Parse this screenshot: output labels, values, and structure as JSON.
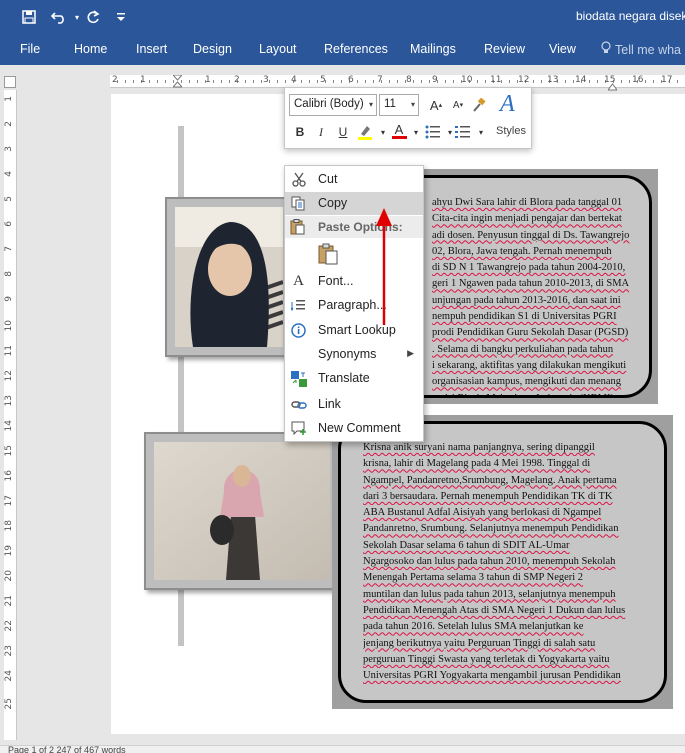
{
  "title_bar": {
    "doc_title": "biodata negara disek",
    "icons": [
      "save-icon",
      "undo-icon",
      "redo-icon",
      "customize-qat-icon"
    ]
  },
  "ribbon": {
    "tabs": [
      "File",
      "Home",
      "Insert",
      "Design",
      "Layout",
      "References",
      "Mailings",
      "Review",
      "View"
    ],
    "tell_me": "Tell me wha"
  },
  "ruler": {
    "h_numbers": [
      "2",
      "1",
      "1",
      "2",
      "3",
      "4",
      "5",
      "6",
      "7",
      "8",
      "9",
      "10",
      "11",
      "12",
      "13",
      "14",
      "15",
      "16",
      "17",
      "18"
    ],
    "v_numbers": [
      "1",
      "2",
      "3",
      "4",
      "5",
      "6",
      "7",
      "8",
      "9",
      "10",
      "11",
      "12",
      "13",
      "14",
      "15",
      "16",
      "17",
      "18",
      "19",
      "20",
      "21",
      "22",
      "23",
      "24",
      "25"
    ]
  },
  "mini_toolbar": {
    "font_name": "Calibri (Body)",
    "font_size": "11",
    "grow_font": "A",
    "shrink_font": "A",
    "bold": "B",
    "italic": "I",
    "underline": "U",
    "font_color_letter": "A",
    "styles_label": "Styles",
    "highlight_color": "#ffff00",
    "font_color": "#e00000"
  },
  "context_menu": {
    "items": [
      {
        "label": "Cut",
        "icon": "scissors-icon"
      },
      {
        "label": "Copy",
        "icon": "copy-icon"
      },
      {
        "label": "Paste Options:",
        "icon": "paste-icon"
      },
      {
        "label": "Font...",
        "icon": "font-icon"
      },
      {
        "label": "Paragraph...",
        "icon": "paragraph-icon"
      },
      {
        "label": "Smart Lookup",
        "icon": "smart-lookup-icon"
      },
      {
        "label": "Synonyms",
        "icon": "synonyms-icon"
      },
      {
        "label": "Translate",
        "icon": "translate-icon"
      },
      {
        "label": "Link",
        "icon": "link-icon"
      },
      {
        "label": "New Comment",
        "icon": "new-comment-icon"
      }
    ]
  },
  "document": {
    "bio1_lines": [
      "ahyu Dwi Sara lahir di Blora pada tanggal 01",
      "Cita-cita ingin menjadi pengajar dan bertekat",
      "adi dosen. Penyusun tinggal di Ds. Tawangrejo",
      "02, Blora, Jawa tengah. Pernah menempuh",
      "di SD N 1 Tawangrejo pada tahun 2004-2010,",
      "geri 1 Ngawen pada tahun 2010-2013, di SMA",
      "unjungan pada tahun 2013-2016, dan saat ini",
      "nempuh pendidikan S1 di Universitas PGRI",
      "prodi Pendidikan Guru Sekolah Dasar (PGSD)",
      ". Selama di bangku perkuliahan pada tahun",
      "i sekarang, aktifitas yang dilakukan mengikuti",
      "organisasian kampus, mengikuti dan menang",
      "petisi Bisnis Mahasiswa Indonesia (KBMI)"
    ],
    "bio2_lines": [
      "Krisna anik suryani nama panjangnya, sering dipanggil",
      "krisna, lahir di Magelang pada 4 Mei 1998. Tinggal di",
      "Ngampel, Pandanretno,Srumbung, Magelang. Anak pertama",
      "dari 3 bersaudara. Pernah menempuh Pendidikan TK di TK",
      "ABA Bustanul Adfal Aisiyah yang berlokasi di Ngampel",
      "Pandanretno, Srumbung. Selanjutnya menempuh Pendidikan",
      "Sekolah Dasar selama 6 tahun di SDIT AL-Umar",
      "Ngargosoko dan lulus pada tahun 2010, menempuh Sekolah",
      "Menengah Pertama selama 3 tahun di SMP Negeri 2",
      "muntilan dan lulus pada tahun 2013, selanjutnya menempuh",
      "Pendidikan Menengah Atas di SMA Negeri 1 Dukun dan lulus",
      "pada tahun 2016. Setelah lulus SMA melanjutkan ke",
      "jenjang berikutnya yaitu Perguruan Tinggi di salah satu",
      "perguruan Tinggi Swasta yang terletak di Yogyakarta yaitu",
      "Universitas PGRI Yogyakarta mengambil jurusan Pendidikan"
    ]
  },
  "status_bar": {
    "text": "Page 1 of 2    247 of 467 words"
  }
}
